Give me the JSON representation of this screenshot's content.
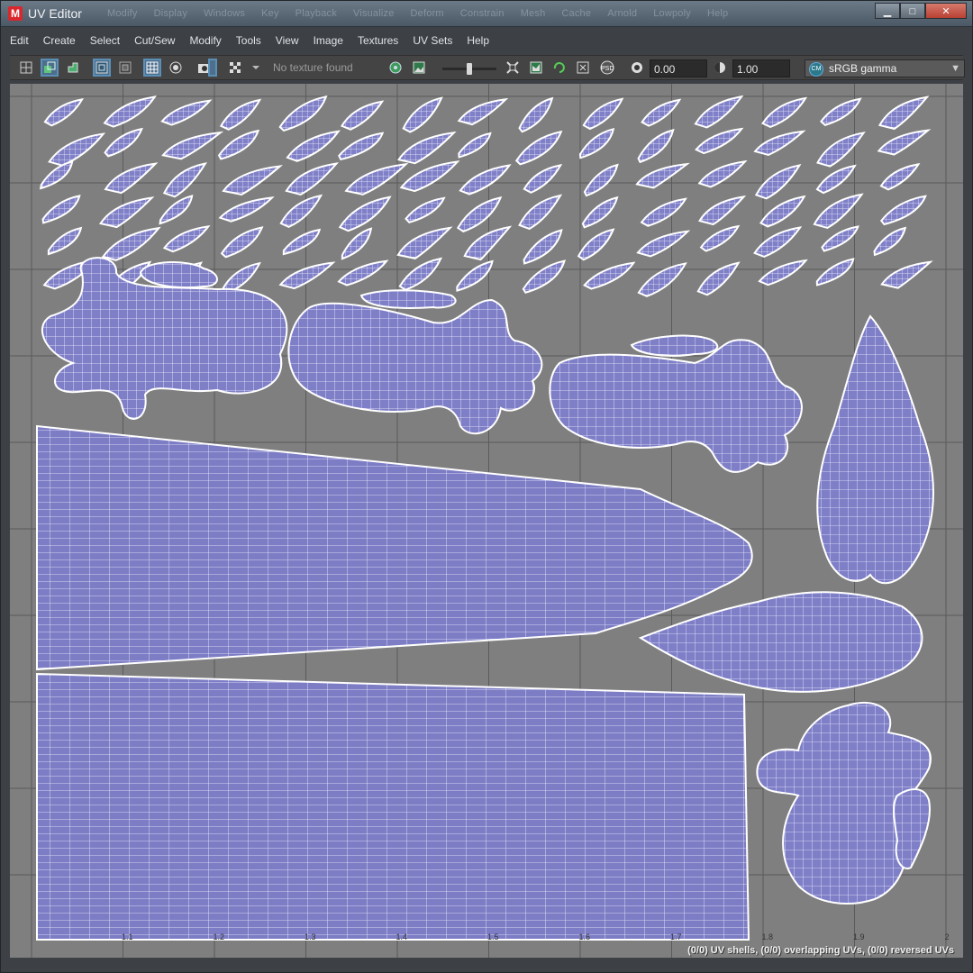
{
  "window": {
    "title": "UV Editor",
    "logo_letter": "M",
    "ghost_menu": [
      "Modify",
      "Display",
      "Windows",
      "Key",
      "Playback",
      "Visualize",
      "Deform",
      "Constrain",
      "Mesh",
      "Cache",
      "Arnold",
      "Lowpoly",
      "Help"
    ]
  },
  "menubar": {
    "items": [
      "Edit",
      "Create",
      "Select",
      "Cut/Sew",
      "Modify",
      "Tools",
      "View",
      "Image",
      "Textures",
      "UV Sets",
      "Help"
    ]
  },
  "toolbar": {
    "no_texture_label": "No texture found",
    "exposure_value": "0.00",
    "gamma_value": "1.00",
    "color_space": "sRGB gamma",
    "brightness_slider_fraction": 0.5,
    "icons": [
      "grid-icon",
      "shaded-uv-icon",
      "texture-borders-icon",
      "uv-layout-icon",
      "distortion-icon",
      "pixel-snap-icon",
      "filter-icon",
      "image-capture-icon",
      "checker-icon",
      "display-image-icon",
      "image-icon",
      "isolate-icon",
      "snapshot-icon",
      "rotate-icon",
      "texel-icon",
      "psd-icon",
      "exposure-icon",
      "gamma-icon",
      "color-management-icon"
    ]
  },
  "viewport": {
    "status_text": "(0/0) UV shells, (0/0) overlapping UVs, (0/0) reversed UVs",
    "grid_labels": [
      "1.1",
      "1.2",
      "1.3",
      "1.4",
      "1.5",
      "1.6",
      "1.7",
      "1.8",
      "1.9",
      "2"
    ],
    "colors": {
      "background": "#7f7f7f",
      "uv_fill": "#7f7fc8",
      "uv_wire": "#ffffff",
      "grid_line": "#5a5a5a"
    }
  }
}
